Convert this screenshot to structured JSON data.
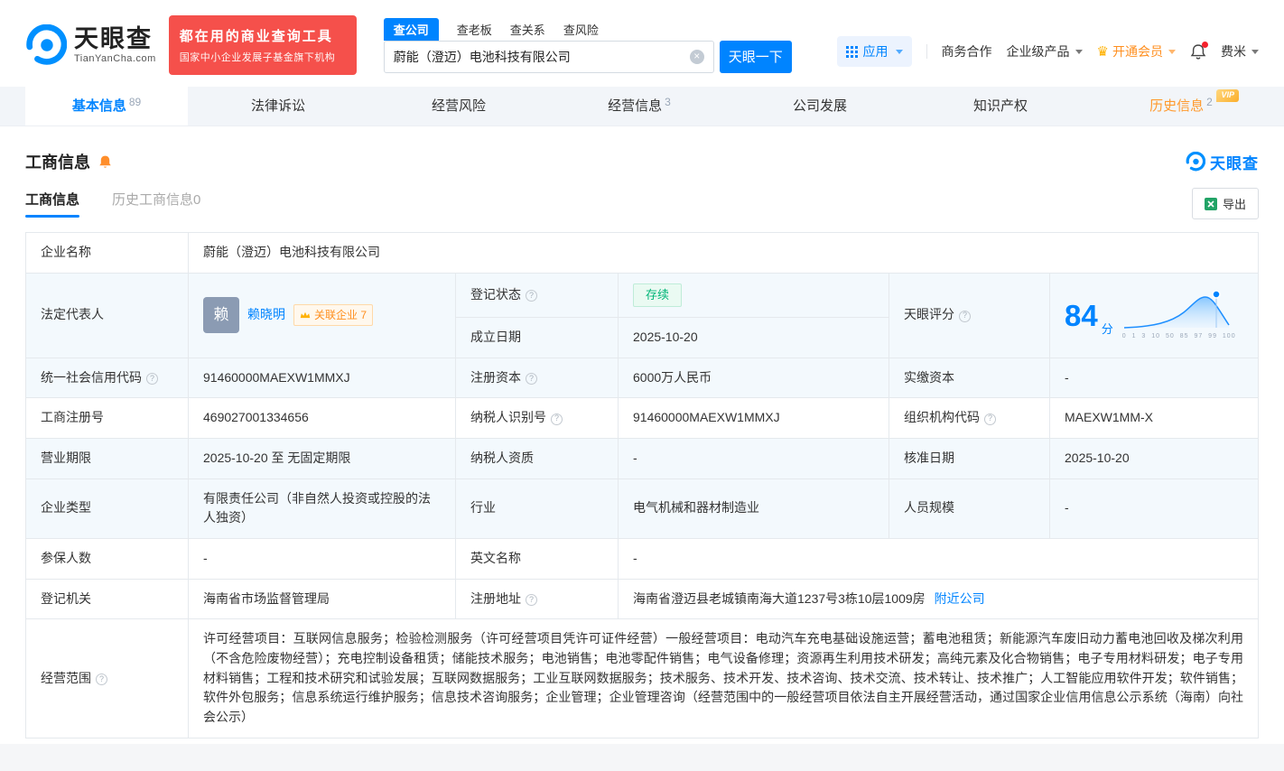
{
  "brand": {
    "name": "天眼查",
    "domain": "TianYanCha.com",
    "slogan_line1": "都在用的商业查询工具",
    "slogan_line2": "国家中小企业发展子基金旗下机构"
  },
  "search": {
    "tabs": [
      {
        "label": "查公司"
      },
      {
        "label": "查老板"
      },
      {
        "label": "查关系"
      },
      {
        "label": "查风险"
      }
    ],
    "input_value": "蔚能（澄迈）电池科技有限公司",
    "button_label": "天眼一下"
  },
  "header_right": {
    "apps_label": "应用",
    "cooperation_label": "商务合作",
    "enterprise_label": "企业级产品",
    "vip_label": "开通会员",
    "username": "费米"
  },
  "nav": {
    "tabs": [
      {
        "label": "基本信息",
        "count": "89"
      },
      {
        "label": "法律诉讼",
        "count": ""
      },
      {
        "label": "经营风险",
        "count": ""
      },
      {
        "label": "经营信息",
        "count": "3"
      },
      {
        "label": "公司发展",
        "count": ""
      },
      {
        "label": "知识产权",
        "count": ""
      },
      {
        "label": "历史信息",
        "count": "2",
        "vip_tag": "VIP"
      }
    ]
  },
  "section": {
    "title": "工商信息",
    "watermark": "天眼查",
    "subtab_active": "工商信息",
    "subtab_history": "历史工商信息0",
    "export_label": "导出"
  },
  "icons": {
    "help": "?",
    "clear": "×",
    "crown": "♛"
  },
  "score_chart": {
    "score": "84",
    "unit": "分",
    "axis_labels": "0 1 3 10 50 85 97 99 100"
  },
  "info": {
    "company_name": {
      "label": "企业名称",
      "value": "蔚能（澄迈）电池科技有限公司"
    },
    "legal_rep": {
      "label": "法定代表人",
      "avatar_char": "赖",
      "name": "赖晓明",
      "badge": "关联企业 7"
    },
    "reg_status": {
      "label": "登记状态",
      "value": "存续"
    },
    "establish_date": {
      "label": "成立日期",
      "value": "2025-10-20"
    },
    "tyc_score": {
      "label": "天眼评分"
    },
    "credit_code": {
      "label": "统一社会信用代码",
      "value": "91460000MAEXW1MMXJ"
    },
    "reg_capital": {
      "label": "注册资本",
      "value": "6000万人民币"
    },
    "paid_capital": {
      "label": "实缴资本",
      "value": "-"
    },
    "reg_number": {
      "label": "工商注册号",
      "value": "469027001334656"
    },
    "taxpayer_id": {
      "label": "纳税人识别号",
      "value": "91460000MAEXW1MMXJ"
    },
    "org_code": {
      "label": "组织机构代码",
      "value": "MAEXW1MM-X"
    },
    "business_term": {
      "label": "营业期限",
      "value": "2025-10-20 至 无固定期限"
    },
    "taxpayer_quality": {
      "label": "纳税人资质",
      "value": "-"
    },
    "approval_date": {
      "label": "核准日期",
      "value": "2025-10-20"
    },
    "company_type": {
      "label": "企业类型",
      "value": "有限责任公司（非自然人投资或控股的法人独资）"
    },
    "industry": {
      "label": "行业",
      "value": "电气机械和器材制造业"
    },
    "staff_size": {
      "label": "人员规模",
      "value": "-"
    },
    "insured_count": {
      "label": "参保人数",
      "value": "-"
    },
    "english_name": {
      "label": "英文名称",
      "value": "-"
    },
    "reg_authority": {
      "label": "登记机关",
      "value": "海南省市场监督管理局"
    },
    "reg_address": {
      "label": "注册地址",
      "value": "海南省澄迈县老城镇南海大道1237号3栋10层1009房",
      "link": "附近公司"
    },
    "business_scope": {
      "label": "经营范围",
      "value": "许可经营项目：互联网信息服务；检验检测服务（许可经营项目凭许可证件经营）一般经营项目：电动汽车充电基础设施运营；蓄电池租赁；新能源汽车废旧动力蓄电池回收及梯次利用（不含危险废物经营）；充电控制设备租赁；储能技术服务；电池销售；电池零配件销售；电气设备修理；资源再生利用技术研发；高纯元素及化合物销售；电子专用材料研发；电子专用材料销售；工程和技术研究和试验发展；互联网数据服务；工业互联网数据服务；技术服务、技术开发、技术咨询、技术交流、技术转让、技术推广；人工智能应用软件开发；软件销售；软件外包服务；信息系统运行维护服务；信息技术咨询服务；企业管理；企业管理咨询（经营范围中的一般经营项目依法自主开展经营活动，通过国家企业信用信息公示系统（海南）向社会公示）"
    }
  }
}
